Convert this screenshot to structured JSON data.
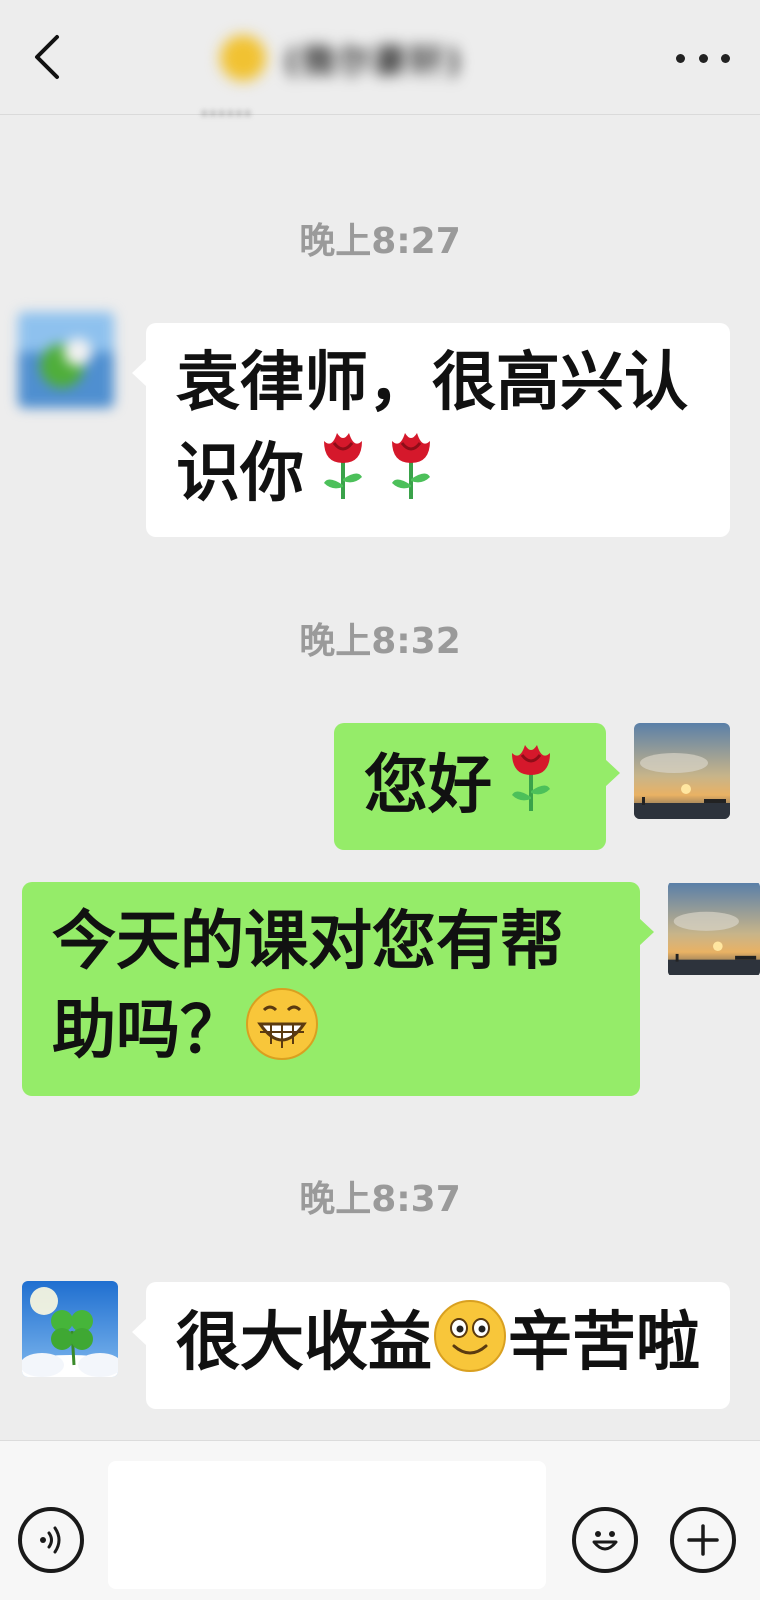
{
  "header": {
    "back_icon": "chevron-left-icon",
    "title": "(微尔豪轩)",
    "more_icon": "more-horizontal-icon",
    "peek_text": "……"
  },
  "messages": [
    {
      "type": "time",
      "text": "晚上8:27"
    },
    {
      "type": "incoming",
      "text": "袁律师，很高兴认识你",
      "emojis": [
        "rose",
        "rose"
      ]
    },
    {
      "type": "time",
      "text": "晚上8:32"
    },
    {
      "type": "outgoing",
      "text": "您好",
      "emojis": [
        "rose"
      ]
    },
    {
      "type": "outgoing",
      "text": "今天的课对您有帮助吗？",
      "emojis": [
        "grin"
      ]
    },
    {
      "type": "time",
      "text": "晚上8:37"
    },
    {
      "type": "incoming",
      "text_a": "很大收益",
      "text_b": "辛苦啦",
      "emojis": [
        "smile"
      ]
    }
  ],
  "input": {
    "value": "",
    "placeholder": ""
  },
  "colors": {
    "background": "#ededed",
    "outgoing_bubble": "#95ec69",
    "incoming_bubble": "#ffffff",
    "timestamp": "#9a9a9a"
  },
  "icons": {
    "voice": "voice-icon",
    "emoji": "emoji-icon",
    "plus": "plus-icon"
  }
}
